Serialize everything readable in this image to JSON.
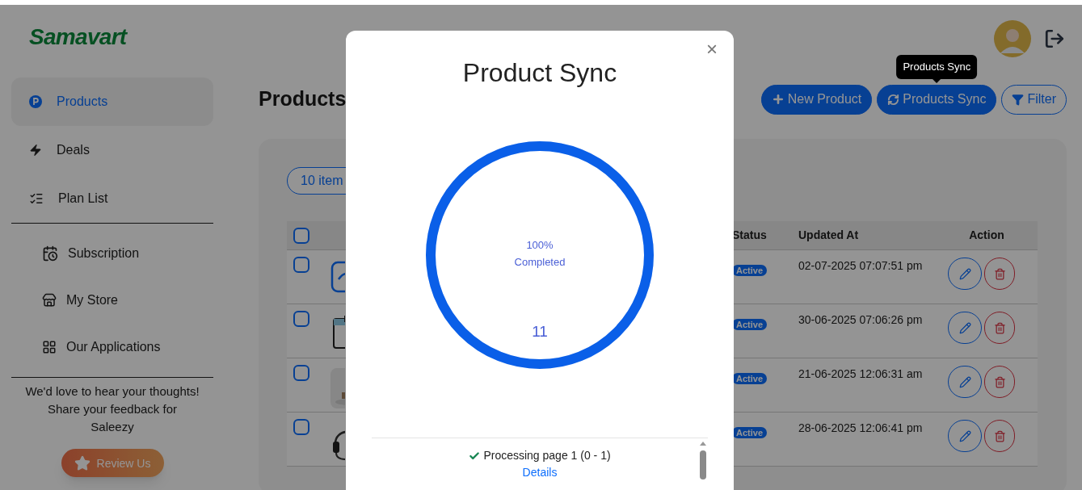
{
  "logo": "Samavart",
  "sidebar": {
    "items": [
      {
        "label": "Products",
        "selected": true
      },
      {
        "label": "Deals",
        "selected": false
      },
      {
        "label": "Plan List",
        "selected": false
      }
    ],
    "secondary_items": [
      {
        "label": "Subscription",
        "selected": false
      },
      {
        "label": "My Store",
        "selected": false
      },
      {
        "label": "Our Applications",
        "selected": false
      }
    ],
    "feedback_lines": [
      "We'd love to hear your thoughts!",
      "Share your feedback for",
      "Saleezy"
    ],
    "review_button": "Review Us"
  },
  "page_title": "Products",
  "actions": [
    {
      "label": "New Product",
      "kind": "primary"
    },
    {
      "label": "Products Sync",
      "kind": "primary",
      "tooltip": "Products Sync"
    },
    {
      "label": "Filter",
      "kind": "outline"
    }
  ],
  "items_pill": "10 item",
  "table": {
    "select_all": {
      "checked": false
    },
    "columns": [
      "Status",
      "Updated At",
      "Action"
    ],
    "rows": [
      {
        "checked": false,
        "status": "Active",
        "updated_at": "02-07-2025 07:07:51 pm"
      },
      {
        "checked": false,
        "status": "Active",
        "updated_at": "30-06-2025 07:06:26 pm"
      },
      {
        "checked": false,
        "status": "Active",
        "updated_at": "21-06-2025 12:06:31 am"
      },
      {
        "checked": false,
        "status": "Active",
        "updated_at": "28-06-2025 12:06:41 pm"
      }
    ]
  },
  "modal": {
    "title": "Product Sync",
    "close": "×",
    "progress": {
      "level": 1,
      "percent": "100%",
      "label": "Completed",
      "count": "11"
    },
    "log": [
      {
        "kind": "step",
        "done": true,
        "text": "Processing page 1 (0 - 1)"
      },
      {
        "kind": "link",
        "text": "Details"
      }
    ]
  }
}
